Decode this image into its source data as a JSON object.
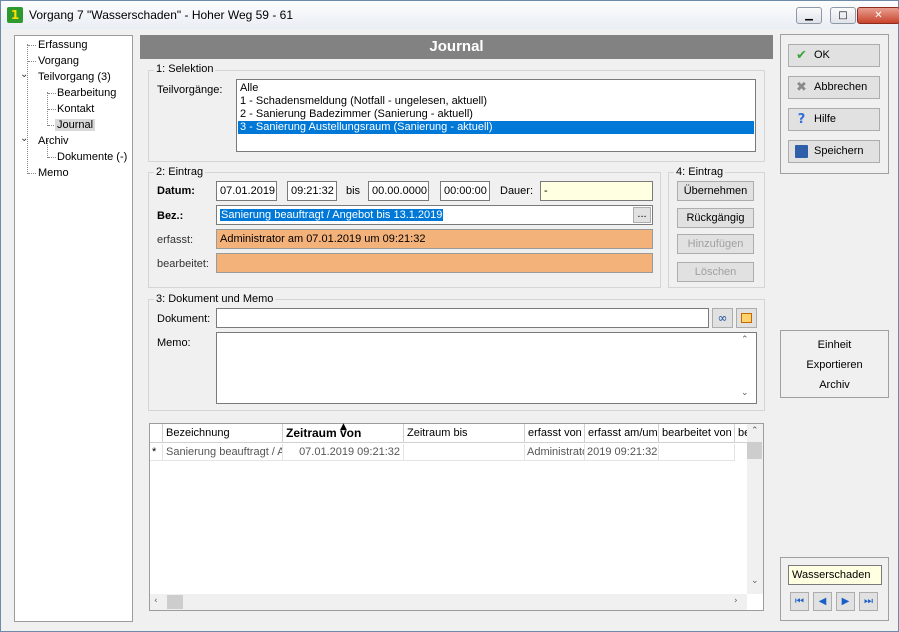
{
  "window": {
    "title": "Vorgang 7 \"Wasserschaden\" - Hoher Weg 59 - 61",
    "app_icon_text": "1",
    "minimize": "▁",
    "maximize": "□",
    "close": "✕"
  },
  "tree": {
    "items": [
      {
        "label": "Erfassung"
      },
      {
        "label": "Vorgang"
      },
      {
        "label": "Teilvorgang (3)"
      },
      {
        "label": "Bearbeitung"
      },
      {
        "label": "Kontakt"
      },
      {
        "label": "Journal",
        "selected": true
      },
      {
        "label": "Archiv"
      },
      {
        "label": "Dokumente (-)"
      },
      {
        "label": "Memo"
      }
    ]
  },
  "header": {
    "title": "Journal"
  },
  "selektion": {
    "group_label": "1: Selektion",
    "teilvorgaenge_label": "Teilvorgänge:",
    "items": [
      "Alle",
      "1 - Schadensmeldung (Notfall - ungelesen, aktuell)",
      "2 - Sanierung Badezimmer (Sanierung - aktuell)",
      "3 - Sanierung Austellungsraum (Sanierung - aktuell)"
    ],
    "selected_index": 3
  },
  "eintrag": {
    "group_label": "2: Eintrag",
    "datum_label": "Datum:",
    "date_from": "07.01.2019",
    "time_from": "09:21:32",
    "bis_label": "bis",
    "date_to": "00.00.0000",
    "time_to": "00:00:00",
    "dauer_label": "Dauer:",
    "dauer_value": "-",
    "bez_label": "Bez.:",
    "bez_value": "Sanierung beauftragt / Angebot bis 13.1.2019",
    "bez_button": "...",
    "erfasst_label": "erfasst:",
    "erfasst_value": "Administrator am 07.01.2019 um 09:21:32",
    "bearbeitet_label": "bearbeitet:",
    "bearbeitet_value": ""
  },
  "eintrag_actions": {
    "group_label": "4: Eintrag",
    "uebernehmen": "Übernehmen",
    "rueckgaengig": "Rückgängig",
    "hinzufuegen": "Hinzufügen",
    "loeschen": "Löschen"
  },
  "dokument": {
    "group_label": "3: Dokument und Memo",
    "dokument_label": "Dokument:",
    "dokument_value": "",
    "memo_label": "Memo:",
    "memo_value": ""
  },
  "grid": {
    "columns": [
      "Bezeichnung",
      "Zeitraum von",
      "Zeitraum bis",
      "erfasst von",
      "erfasst am/um",
      "bearbeitet von",
      "be"
    ],
    "sorted_column": "Zeitraum von",
    "rows": [
      {
        "marker": "*",
        "bezeichnung": "Sanierung beauftragt / A",
        "zeitraum_von": "07.01.2019 09:21:32",
        "zeitraum_bis": "",
        "erfasst_von": "Administrato",
        "erfasst_am": "2019 09:21:32",
        "bearbeitet_von": ""
      }
    ]
  },
  "sidebar_buttons": {
    "ok": "OK",
    "abbrechen": "Abbrechen",
    "hilfe": "Hilfe",
    "speichern": "Speichern"
  },
  "sidebar_links": {
    "einheit": "Einheit",
    "exportieren": "Exportieren",
    "archiv": "Archiv"
  },
  "navigator": {
    "current": "Wasserschaden",
    "first": "⏮",
    "prev": "◀",
    "next": "▶",
    "last": "⏭"
  },
  "colors": {
    "header_bg": "#828282",
    "selection": "#0078d7",
    "readonly_orange": "#f4b27b",
    "dauer_bg": "#ffffe1"
  }
}
